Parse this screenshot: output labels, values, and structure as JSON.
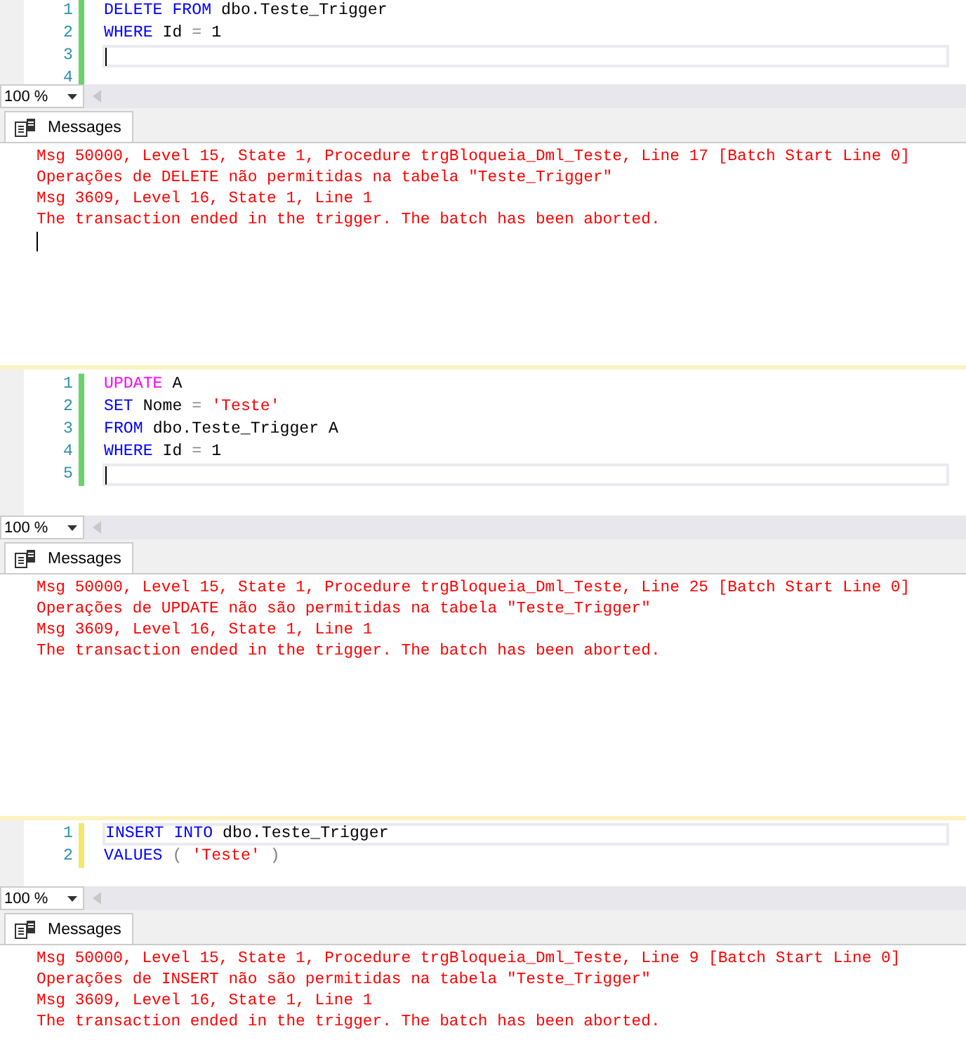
{
  "panels": [
    {
      "editor": {
        "saved": true,
        "lines": [
          {
            "number": "1",
            "current": false,
            "tokens": [
              {
                "text": "DELETE",
                "kind": "keyword"
              },
              {
                "text": "FROM",
                "kind": "keyword"
              },
              {
                "text": "dbo.Teste_Trigger",
                "kind": "text"
              }
            ]
          },
          {
            "number": "2",
            "current": false,
            "tokens": [
              {
                "text": "WHERE",
                "kind": "keyword"
              },
              {
                "text": "Id",
                "kind": "text"
              },
              {
                "text": "=",
                "kind": "operator"
              },
              {
                "text": "1",
                "kind": "text"
              }
            ]
          },
          {
            "number": "3",
            "current": true
          },
          {
            "number": "4",
            "current": false
          }
        ]
      },
      "zoom": "100 %",
      "tab": "Messages",
      "messages": [
        "Msg 50000, Level 15, State 1, Procedure trgBloqueia_Dml_Teste, Line 17 [Batch Start Line 0]",
        "Operações de DELETE não permitidas na tabela \"Teste_Trigger\"",
        "Msg 3609, Level 16, State 1, Line 1",
        "The transaction ended in the trigger. The batch has been aborted."
      ],
      "cursor": true
    },
    {
      "editor": {
        "saved": true,
        "lines": [
          {
            "number": "1",
            "current": false,
            "tokens": [
              {
                "text": "UPDATE",
                "kind": "dml"
              },
              {
                "text": "A",
                "kind": "text"
              }
            ]
          },
          {
            "number": "2",
            "current": false,
            "tokens": [
              {
                "text": "SET",
                "kind": "keyword"
              },
              {
                "text": "Nome",
                "kind": "text"
              },
              {
                "text": "=",
                "kind": "operator"
              },
              {
                "text": "'Teste'",
                "kind": "string"
              }
            ]
          },
          {
            "number": "3",
            "current": false,
            "tokens": [
              {
                "text": "FROM",
                "kind": "keyword"
              },
              {
                "text": "dbo.Teste_Trigger A",
                "kind": "text"
              }
            ]
          },
          {
            "number": "4",
            "current": false,
            "tokens": [
              {
                "text": "WHERE",
                "kind": "keyword"
              },
              {
                "text": "Id",
                "kind": "text"
              },
              {
                "text": "=",
                "kind": "operator"
              },
              {
                "text": "1",
                "kind": "text"
              }
            ]
          },
          {
            "number": "5",
            "current": true
          }
        ]
      },
      "zoom": "100 %",
      "tab": "Messages",
      "messages": [
        "Msg 50000, Level 15, State 1, Procedure trgBloqueia_Dml_Teste, Line 25 [Batch Start Line 0]",
        "Operações de UPDATE não são permitidas na tabela \"Teste_Trigger\"",
        "Msg 3609, Level 16, State 1, Line 1",
        "The transaction ended in the trigger. The batch has been aborted."
      ]
    },
    {
      "editor": {
        "saved": false,
        "lines": [
          {
            "number": "1",
            "current": true,
            "tokens": [
              {
                "text": "INSERT",
                "kind": "keyword"
              },
              {
                "text": "INTO",
                "kind": "keyword"
              },
              {
                "text": "dbo.Teste_Trigger",
                "kind": "text"
              }
            ]
          },
          {
            "number": "2",
            "current": false,
            "tokens": [
              {
                "text": "VALUES",
                "kind": "keyword"
              },
              {
                "text": "(",
                "kind": "operator"
              },
              {
                "text": "'Teste'",
                "kind": "string"
              },
              {
                "text": ")",
                "kind": "operator"
              }
            ]
          }
        ]
      },
      "zoom": "100 %",
      "tab": "Messages",
      "messages": [
        "Msg 50000, Level 15, State 1, Procedure trgBloqueia_Dml_Teste, Line 9 [Batch Start Line 0]",
        "Operações de INSERT não são permitidas na tabela \"Teste_Trigger\"",
        "Msg 3609, Level 16, State 1, Line 1",
        "The transaction ended in the trigger. The batch has been aborted."
      ]
    }
  ]
}
